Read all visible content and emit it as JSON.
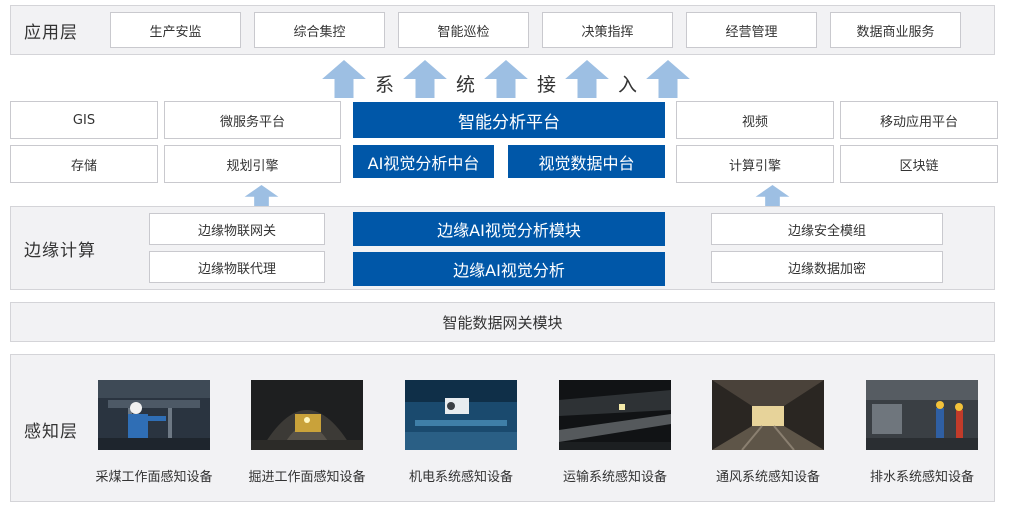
{
  "app_layer": {
    "title": "应用层",
    "items": [
      "生产安监",
      "综合集控",
      "智能巡检",
      "决策指挥",
      "经营管理",
      "数据商业服务"
    ]
  },
  "access_banner": [
    "系",
    "统",
    "接",
    "入"
  ],
  "platform": {
    "left": [
      "GIS",
      "微服务平台",
      "存储",
      "规划引擎"
    ],
    "center_top": "智能分析平台",
    "center_left": "AI视觉分析中台",
    "center_right": "视觉数据中台",
    "right": [
      "视频",
      "移动应用平台",
      "计算引擎",
      "区块链"
    ]
  },
  "edge": {
    "title": "边缘计算",
    "left": [
      "边缘物联网关",
      "边缘物联代理"
    ],
    "center": [
      "边缘AI视觉分析模块",
      "边缘AI视觉分析"
    ],
    "right": [
      "边缘安全模组",
      "边缘数据加密"
    ]
  },
  "gateway": {
    "label": "智能数据网关模块"
  },
  "perception": {
    "title": "感知层",
    "devices": [
      "采煤工作面感知设备",
      "掘进工作面感知设备",
      "机电系统感知设备",
      "运输系统感知设备",
      "通风系统感知设备",
      "排水系统感知设备"
    ]
  },
  "colors": {
    "accent_blue": "#0057a8",
    "arrow_blue": "#9dbfe3",
    "panel_gray": "#f2f2f4"
  }
}
